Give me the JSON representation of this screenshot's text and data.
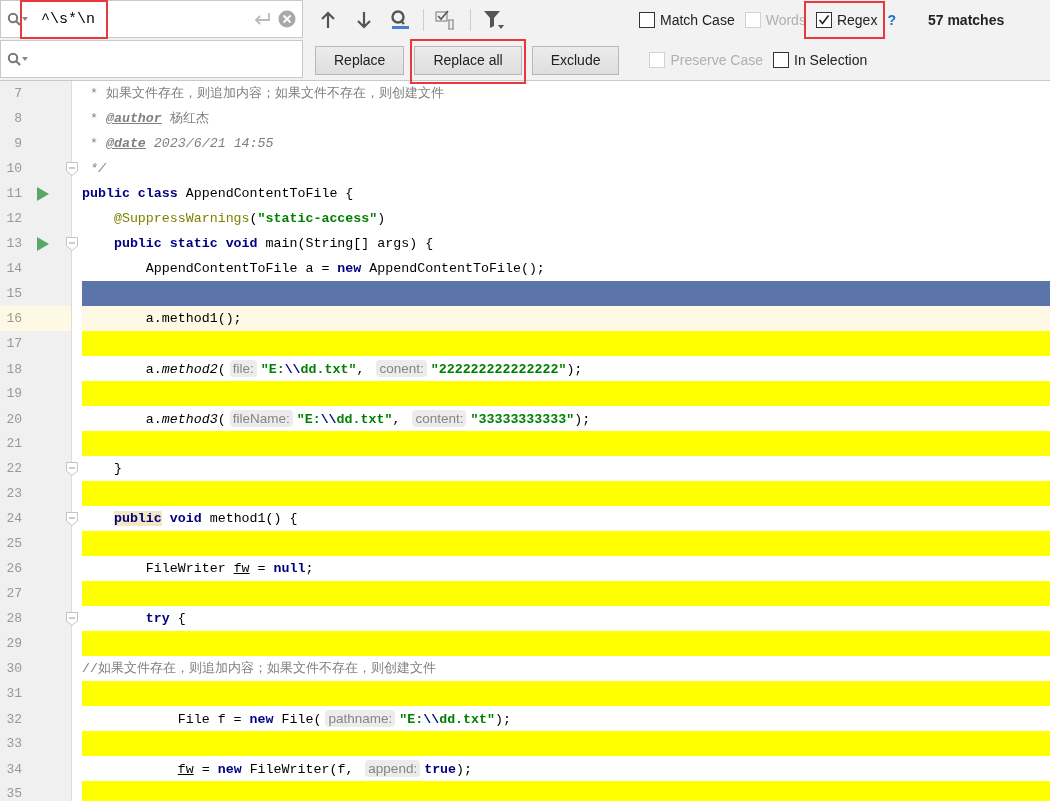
{
  "find_bar": {
    "search": {
      "value": "^\\s*\\n",
      "highlighted": true
    },
    "options_row1": [
      {
        "label": "Match Case",
        "checked": false,
        "disabled": false,
        "highlighted": false
      },
      {
        "label": "Words",
        "checked": false,
        "disabled": true,
        "highlighted": false
      },
      {
        "label": "Regex",
        "checked": true,
        "disabled": false,
        "highlighted": true
      }
    ],
    "help": "?",
    "match_count": "57 matches",
    "buttons": [
      {
        "label": "Replace",
        "highlighted": false
      },
      {
        "label": "Replace all",
        "highlighted": true
      },
      {
        "label": "Exclude",
        "highlighted": false
      }
    ],
    "options_row2": [
      {
        "label": "Preserve Case",
        "checked": false,
        "disabled": true,
        "highlighted": false
      },
      {
        "label": "In Selection",
        "checked": false,
        "disabled": false,
        "highlighted": false
      }
    ]
  },
  "editor": {
    "lines": [
      {
        "number": "7",
        "selected": false,
        "caret": false,
        "match": false,
        "run": false,
        "fold": false,
        "tokens": [
          {
            "kind": "comment",
            "text": " * 如果文件存在，则追加内容；如果文件不存在，则创建文件"
          }
        ]
      },
      {
        "number": "8",
        "selected": false,
        "caret": false,
        "match": false,
        "run": false,
        "fold": false,
        "tokens": [
          {
            "kind": "comment",
            "text": " * "
          },
          {
            "kind": "doc_tag",
            "text": "@author"
          },
          {
            "kind": "comment",
            "text": " 杨红杰"
          }
        ]
      },
      {
        "number": "9",
        "selected": false,
        "caret": false,
        "match": false,
        "run": false,
        "fold": false,
        "tokens": [
          {
            "kind": "comment",
            "text": " * "
          },
          {
            "kind": "doc_tag",
            "text": "@date"
          },
          {
            "kind": "comment_italic",
            "text": " 2023/6/21 14:55"
          }
        ]
      },
      {
        "number": "10",
        "selected": false,
        "caret": false,
        "match": false,
        "run": false,
        "fold": true,
        "tokens": [
          {
            "kind": "comment_italic",
            "text": " */"
          }
        ]
      },
      {
        "number": "11",
        "selected": false,
        "caret": false,
        "match": false,
        "run": true,
        "fold": false,
        "tokens": [
          {
            "kind": "keyword",
            "text": "public class"
          },
          {
            "kind": "plain",
            "text": " AppendContentToFile {"
          }
        ]
      },
      {
        "number": "12",
        "selected": false,
        "caret": false,
        "match": false,
        "run": false,
        "fold": false,
        "tokens": [
          {
            "kind": "annotation",
            "text": "    @SuppressWarnings"
          },
          {
            "kind": "plain",
            "text": "("
          },
          {
            "kind": "string",
            "text": "\"static-access\""
          },
          {
            "kind": "plain",
            "text": ")"
          }
        ]
      },
      {
        "number": "13",
        "selected": false,
        "caret": false,
        "match": false,
        "run": true,
        "fold": true,
        "tokens": [
          {
            "kind": "keyword",
            "text": "    public static void"
          },
          {
            "kind": "plain",
            "text": " main(String[] args) {"
          }
        ]
      },
      {
        "number": "14",
        "selected": false,
        "caret": false,
        "match": false,
        "run": false,
        "fold": false,
        "tokens": [
          {
            "kind": "plain",
            "text": "        AppendContentToFile a = "
          },
          {
            "kind": "keyword",
            "text": "new"
          },
          {
            "kind": "plain",
            "text": " AppendContentToFile();"
          }
        ]
      },
      {
        "number": "15",
        "selected": true,
        "caret": false,
        "match": false,
        "run": false,
        "fold": false
      },
      {
        "number": "16",
        "selected": false,
        "caret": true,
        "match": false,
        "run": false,
        "fold": false,
        "tokens": [
          {
            "kind": "plain",
            "text": "        a.method1();"
          }
        ]
      },
      {
        "number": "17",
        "selected": false,
        "caret": false,
        "match": true,
        "run": false,
        "fold": false
      },
      {
        "number": "18",
        "selected": false,
        "caret": false,
        "match": false,
        "run": false,
        "fold": false,
        "tokens": [
          {
            "kind": "plain",
            "text": "        a."
          },
          {
            "kind": "method",
            "text": "method2"
          },
          {
            "kind": "plain",
            "text": "("
          },
          {
            "kind": "hint",
            "text": "file:"
          },
          {
            "kind": "string",
            "text": "\"E:"
          },
          {
            "kind": "escape",
            "text": "\\\\"
          },
          {
            "kind": "string",
            "text": "dd.txt\""
          },
          {
            "kind": "plain",
            "text": ", "
          },
          {
            "kind": "hint",
            "text": "conent:"
          },
          {
            "kind": "string",
            "text": "\"222222222222222\""
          },
          {
            "kind": "plain",
            "text": ");"
          }
        ]
      },
      {
        "number": "19",
        "selected": false,
        "caret": false,
        "match": true,
        "run": false,
        "fold": false
      },
      {
        "number": "20",
        "selected": false,
        "caret": false,
        "match": false,
        "run": false,
        "fold": false,
        "tokens": [
          {
            "kind": "plain",
            "text": "        a."
          },
          {
            "kind": "method",
            "text": "method3"
          },
          {
            "kind": "plain",
            "text": "("
          },
          {
            "kind": "hint",
            "text": "fileName:"
          },
          {
            "kind": "string",
            "text": "\"E:"
          },
          {
            "kind": "escape",
            "text": "\\\\"
          },
          {
            "kind": "string",
            "text": "dd.txt\""
          },
          {
            "kind": "plain",
            "text": ", "
          },
          {
            "kind": "hint",
            "text": "content:"
          },
          {
            "kind": "string",
            "text": "\"33333333333\""
          },
          {
            "kind": "plain",
            "text": ");"
          }
        ]
      },
      {
        "number": "21",
        "selected": false,
        "caret": false,
        "match": true,
        "run": false,
        "fold": false
      },
      {
        "number": "22",
        "selected": false,
        "caret": false,
        "match": false,
        "run": false,
        "fold": true,
        "tokens": [
          {
            "kind": "plain",
            "text": "    }"
          }
        ]
      },
      {
        "number": "23",
        "selected": false,
        "caret": false,
        "match": true,
        "run": false,
        "fold": false
      },
      {
        "number": "24",
        "selected": false,
        "caret": false,
        "match": false,
        "run": false,
        "fold": true,
        "tokens": [
          {
            "kind": "keyword_marked",
            "text": "    public"
          },
          {
            "kind": "keyword",
            "text": " void"
          },
          {
            "kind": "plain",
            "text": " method1() {"
          }
        ]
      },
      {
        "number": "25",
        "selected": false,
        "caret": false,
        "match": true,
        "run": false,
        "fold": false
      },
      {
        "number": "26",
        "selected": false,
        "caret": false,
        "match": false,
        "run": false,
        "fold": false,
        "tokens": [
          {
            "kind": "plain",
            "text": "        FileWriter "
          },
          {
            "kind": "underlined",
            "text": "fw"
          },
          {
            "kind": "plain",
            "text": " = "
          },
          {
            "kind": "keyword",
            "text": "null"
          },
          {
            "kind": "plain",
            "text": ";"
          }
        ]
      },
      {
        "number": "27",
        "selected": false,
        "caret": false,
        "match": true,
        "run": false,
        "fold": false
      },
      {
        "number": "28",
        "selected": false,
        "caret": false,
        "match": false,
        "run": false,
        "fold": true,
        "tokens": [
          {
            "kind": "keyword",
            "text": "        try"
          },
          {
            "kind": "plain",
            "text": " {"
          }
        ]
      },
      {
        "number": "29",
        "selected": false,
        "caret": false,
        "match": true,
        "run": false,
        "fold": false
      },
      {
        "number": "30",
        "selected": false,
        "caret": false,
        "match": false,
        "run": false,
        "fold": false,
        "tokens": [
          {
            "kind": "comment",
            "text": "//如果文件存在，则追加内容；如果文件不存在，则创建文件"
          }
        ]
      },
      {
        "number": "31",
        "selected": false,
        "caret": false,
        "match": true,
        "run": false,
        "fold": false
      },
      {
        "number": "32",
        "selected": false,
        "caret": false,
        "match": false,
        "run": false,
        "fold": false,
        "tokens": [
          {
            "kind": "plain",
            "text": "            File f = "
          },
          {
            "kind": "keyword",
            "text": "new"
          },
          {
            "kind": "plain",
            "text": " File("
          },
          {
            "kind": "hint",
            "text": "pathname:"
          },
          {
            "kind": "string",
            "text": "\"E:"
          },
          {
            "kind": "escape",
            "text": "\\\\"
          },
          {
            "kind": "string",
            "text": "dd.txt\""
          },
          {
            "kind": "plain",
            "text": ");"
          }
        ]
      },
      {
        "number": "33",
        "selected": false,
        "caret": false,
        "match": true,
        "run": false,
        "fold": false
      },
      {
        "number": "34",
        "selected": false,
        "caret": false,
        "match": false,
        "run": false,
        "fold": false,
        "tokens": [
          {
            "kind": "underlined",
            "text": "            fw"
          },
          {
            "kind": "plain",
            "text": " = "
          },
          {
            "kind": "keyword",
            "text": "new"
          },
          {
            "kind": "plain",
            "text": " FileWriter(f, "
          },
          {
            "kind": "hint",
            "text": "append:"
          },
          {
            "kind": "keyword",
            "text": "true"
          },
          {
            "kind": "plain",
            "text": ");"
          }
        ]
      },
      {
        "number": "35",
        "selected": false,
        "caret": false,
        "match": true,
        "run": false,
        "fold": false
      }
    ]
  }
}
